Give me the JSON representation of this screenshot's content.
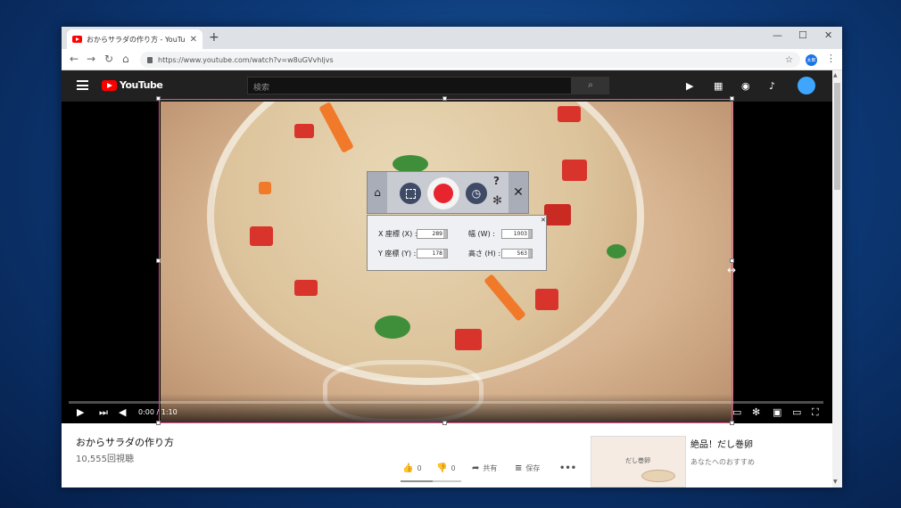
{
  "browser": {
    "tab_title": "おからサラダの作り方 - YouTube",
    "url": "https://www.youtube.com/watch?v=w8uGVvhljvs",
    "profile_label": "太郎"
  },
  "youtube": {
    "logo_text": "YouTube",
    "search_placeholder": "検索"
  },
  "player": {
    "time_current": "0:00",
    "time_separator": " / ",
    "time_total": "1:10"
  },
  "video": {
    "title": "おからサラダの作り方",
    "views": "10,555回視聴",
    "likes": "0",
    "dislikes": "0",
    "share_label": "共有",
    "save_label": "保存"
  },
  "recommendation": {
    "thumb_text": "だし巻卵",
    "title": "絶品！だし巻卵",
    "subtitle": "あなたへのおすすめ"
  },
  "capture_tool": {
    "x_label": "X 座標 (X) :",
    "x_value": "289",
    "y_label": "Y 座標 (Y) :",
    "y_value": "178",
    "w_label": "幅 (W) :",
    "w_value": "1003",
    "h_label": "高さ (H) :",
    "h_value": "563",
    "help_glyph": "?"
  },
  "colors": {
    "selection_border": "#e0509b",
    "record_button": "#e8242f",
    "youtube_red": "#ff0000"
  }
}
